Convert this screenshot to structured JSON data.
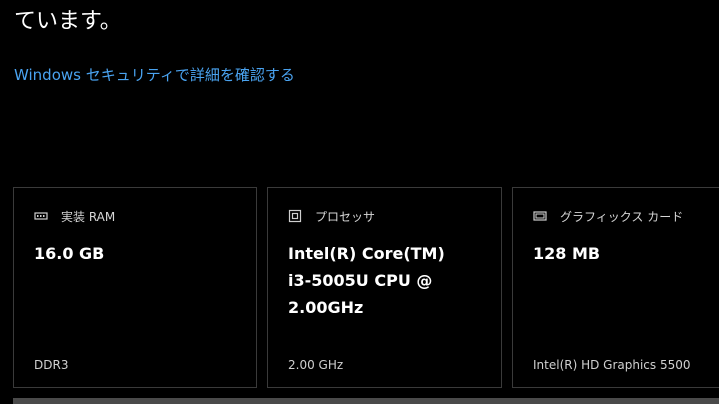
{
  "header": {
    "heading_fragment": "ています。",
    "security_link": "Windows セキュリティで詳細を確認する"
  },
  "cards": [
    {
      "id": "ram",
      "icon": "memory-module-icon",
      "title": "実装 RAM",
      "value": "16.0 GB",
      "sub": "DDR3"
    },
    {
      "id": "cpu",
      "icon": "processor-chip-icon",
      "title": "プロセッサ",
      "value": "Intel(R) Core(TM) i3-5005U CPU @ 2.00GHz",
      "sub": "2.00 GHz"
    },
    {
      "id": "gpu",
      "icon": "graphics-card-icon",
      "title": "グラフィックス カード",
      "value": "128 MB",
      "sub": "Intel(R) HD Graphics 5500"
    }
  ],
  "colors": {
    "background": "#000000",
    "link": "#4aa3f0",
    "card_border": "#3a3a3a"
  }
}
